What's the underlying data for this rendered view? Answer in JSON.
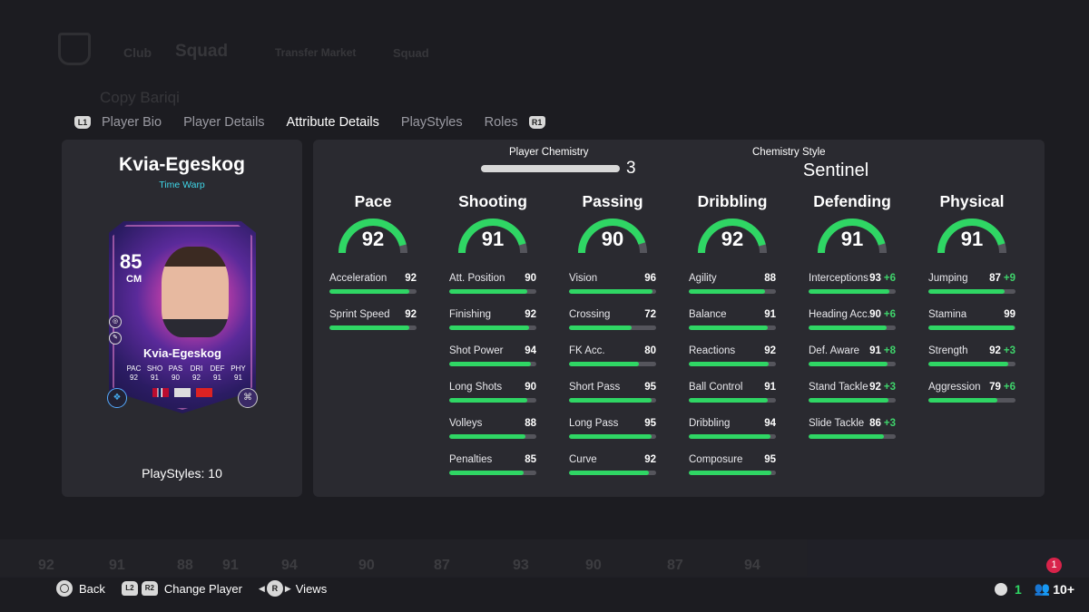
{
  "background": {
    "nav": [
      "Club",
      "Squad",
      "Transfer Market",
      "Squad"
    ],
    "squad_name": "Copy Bariqi",
    "card_ratings": [
      "92",
      "91",
      "88",
      "91",
      "94",
      "90",
      "87",
      "93",
      "90",
      "87",
      "94"
    ]
  },
  "tabs": {
    "left_button": "L1",
    "right_button": "R1",
    "items": [
      "Player Bio",
      "Player Details",
      "Attribute Details",
      "PlayStyles",
      "Roles"
    ],
    "active": "Attribute Details"
  },
  "player": {
    "name": "Kvia-Egeskog",
    "version": "Time Warp",
    "card": {
      "rating": "85",
      "position": "CM",
      "name": "Kvia-Egeskog",
      "stat_labels": [
        "PAC",
        "SHO",
        "PAS",
        "DRI",
        "DEF",
        "PHY"
      ],
      "stat_values": [
        "92",
        "91",
        "90",
        "92",
        "91",
        "91"
      ]
    },
    "playstyles_label": "PlayStyles: 10"
  },
  "chemistry": {
    "player_label": "Player Chemistry",
    "player_value": "3",
    "style_label": "Chemistry Style",
    "style_value": "Sentinel"
  },
  "categories": [
    {
      "name": "Pace",
      "value": 92,
      "attributes": [
        {
          "name": "Acceleration",
          "value": "92",
          "boost": "",
          "fill": 0.92
        },
        {
          "name": "Sprint Speed",
          "value": "92",
          "boost": "",
          "fill": 0.92
        }
      ]
    },
    {
      "name": "Shooting",
      "value": 91,
      "attributes": [
        {
          "name": "Att. Position",
          "value": "90",
          "boost": "",
          "fill": 0.9
        },
        {
          "name": "Finishing",
          "value": "92",
          "boost": "",
          "fill": 0.92
        },
        {
          "name": "Shot Power",
          "value": "94",
          "boost": "",
          "fill": 0.94
        },
        {
          "name": "Long Shots",
          "value": "90",
          "boost": "",
          "fill": 0.9
        },
        {
          "name": "Volleys",
          "value": "88",
          "boost": "",
          "fill": 0.88
        },
        {
          "name": "Penalties",
          "value": "85",
          "boost": "",
          "fill": 0.85
        }
      ]
    },
    {
      "name": "Passing",
      "value": 90,
      "attributes": [
        {
          "name": "Vision",
          "value": "96",
          "boost": "",
          "fill": 0.96
        },
        {
          "name": "Crossing",
          "value": "72",
          "boost": "",
          "fill": 0.72
        },
        {
          "name": "FK Acc.",
          "value": "80",
          "boost": "",
          "fill": 0.8
        },
        {
          "name": "Short Pass",
          "value": "95",
          "boost": "",
          "fill": 0.95
        },
        {
          "name": "Long Pass",
          "value": "95",
          "boost": "",
          "fill": 0.95
        },
        {
          "name": "Curve",
          "value": "92",
          "boost": "",
          "fill": 0.92
        }
      ]
    },
    {
      "name": "Dribbling",
      "value": 92,
      "attributes": [
        {
          "name": "Agility",
          "value": "88",
          "boost": "",
          "fill": 0.88
        },
        {
          "name": "Balance",
          "value": "91",
          "boost": "",
          "fill": 0.91
        },
        {
          "name": "Reactions",
          "value": "92",
          "boost": "",
          "fill": 0.92
        },
        {
          "name": "Ball Control",
          "value": "91",
          "boost": "",
          "fill": 0.91
        },
        {
          "name": "Dribbling",
          "value": "94",
          "boost": "",
          "fill": 0.94
        },
        {
          "name": "Composure",
          "value": "95",
          "boost": "",
          "fill": 0.95
        }
      ]
    },
    {
      "name": "Defending",
      "value": 91,
      "attributes": [
        {
          "name": "Interceptions",
          "value": "93",
          "boost": "+6",
          "fill": 0.93
        },
        {
          "name": "Heading Acc.",
          "value": "90",
          "boost": "+6",
          "fill": 0.9
        },
        {
          "name": "Def. Aware",
          "value": "91",
          "boost": "+8",
          "fill": 0.91
        },
        {
          "name": "Stand Tackle",
          "value": "92",
          "boost": "+3",
          "fill": 0.92
        },
        {
          "name": "Slide Tackle",
          "value": "86",
          "boost": "+3",
          "fill": 0.86
        }
      ]
    },
    {
      "name": "Physical",
      "value": 91,
      "attributes": [
        {
          "name": "Jumping",
          "value": "87",
          "boost": "+9",
          "fill": 0.87
        },
        {
          "name": "Stamina",
          "value": "99",
          "boost": "",
          "fill": 0.99
        },
        {
          "name": "Strength",
          "value": "92",
          "boost": "+3",
          "fill": 0.92
        },
        {
          "name": "Aggression",
          "value": "79",
          "boost": "+6",
          "fill": 0.79
        }
      ]
    }
  ],
  "footer": {
    "back": "Back",
    "l2": "L2",
    "r2": "R2",
    "change_player": "Change Player",
    "r_button": "R",
    "views": "Views",
    "online_count": "1",
    "friends_count": "10+",
    "notifications": "1"
  },
  "colors": {
    "accent_green": "#2fd664",
    "boost_green": "#3fd36b",
    "version_cyan": "#3fd7e8",
    "panel": "#2a2a30"
  }
}
